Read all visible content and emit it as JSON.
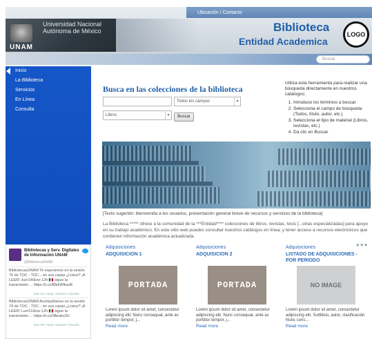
{
  "header": {
    "topbar_text": "Ubicación / Contacto",
    "university_name": "Universidad Nacional Autónoma de México",
    "unam_label": "UNAM",
    "title": "Biblioteca",
    "subtitle": "Entidad Academica",
    "logo_text": "LOGO",
    "search_placeholder": "Buscar"
  },
  "sidebar": {
    "items": [
      {
        "label": "Inicio"
      },
      {
        "label": "La Biblioteca"
      },
      {
        "label": "Servicios"
      },
      {
        "label": "En Línea"
      },
      {
        "label": "Consulta"
      }
    ]
  },
  "twitter": {
    "name": "Bibliotecas y Serv. Digitales de Información UNAM",
    "handle": "@BibliotecaUNAM",
    "tweets": [
      {
        "text": "BibliotecasUNAM Te esperamos en la sesión 75 de TOC - TOC... en sus casas ¿Listos? ¡A LEER! Jue/14/Ene-12h 🇲🇽 sigue la transmisión ... https://t.co/BlbkWlkaxB",
        "meta": "Ene 12 • reply • retweet • favorite"
      },
      {
        "text": "BibliotecasUNAM Acompáñanos en la sesión 74 de TOC - TOC... en sus casas ¿Listos? ¡A LEER! Lun/11/Ene-12h 🇲🇽 sigue la transmisión ... https://t.co/0fbraks3U",
        "meta": "Ene 09 • reply • retweet • favorite"
      }
    ]
  },
  "search": {
    "title": "Busca en las colecciones de la biblioteca",
    "field_select": "Todos los campos",
    "material_select": "Libros",
    "button_label": "Buscar",
    "help_intro": "Utiliza esta herramienta para realizar una búsqueda directamente en nuestros catálogos:",
    "help_steps": [
      "Introduce los términos a buscar",
      "Selecciona el campo de búsqueda (Todos, título, autor, etc.)",
      "Selecciona el tipo de material (Libros, revistas, etc.)",
      "Da clic en Buscar"
    ]
  },
  "banner": {
    "caption": "[Texto sugerido: bienvenida a los usuarios, presentación general breve de recursos y servicios de la biblioteca]",
    "description": "La Biblioteca ***** ofrece a la comunidad de la ***Entidad**** colecciones de libros, revistas, tesis [...otras especializadas] para apoyo en su trabajo académico. En este sitio web puedes consultar nuestros catálogos en línea; y tener acceso a recursos electrónicos que contienen información académica actualizada."
  },
  "acquisitions": [
    {
      "category": "Adquisiciones",
      "title": "ADQUISICION 1",
      "cover": "PORTADA",
      "text": "Lorem ipsum dolor sit amet, consectetur adipiscing elit. Nunc consequat, ante ac porttitor tempor, j...",
      "more": "Read more"
    },
    {
      "category": "Adquisiciones",
      "title": "ADQUISICION 2",
      "cover": "PORTADA",
      "text": "Lorem ipsum dolor sit amet, consectetur adipiscing elit. Nunc consequat, ante ac porttitor tempor, j...",
      "more": "Read more"
    },
    {
      "category": "Adquisiciones",
      "title": "LISTADO DE ADQUISICIONES - POR PERIODO",
      "cover": "NO IMAGE",
      "text": "Lorem ipsum dolor sit amet, consectetur adipiscing elit. Suttilluio, autor, clasificación Nunc cons...",
      "more": "Read more"
    }
  ],
  "carousel_dots": "●●●"
}
